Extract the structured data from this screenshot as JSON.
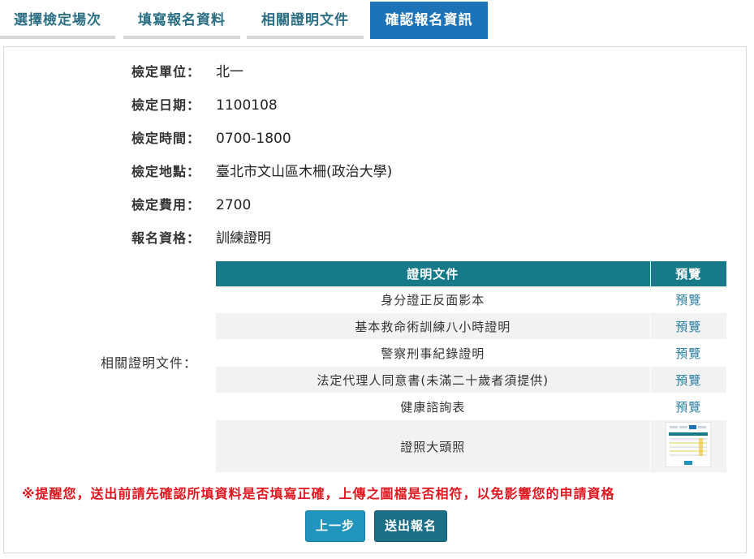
{
  "tabs": [
    {
      "label": "選擇檢定場次",
      "active": false
    },
    {
      "label": "填寫報名資料",
      "active": false
    },
    {
      "label": "相關證明文件",
      "active": false
    },
    {
      "label": "確認報名資訊",
      "active": true
    }
  ],
  "fields": {
    "unit": {
      "label": "檢定單位：",
      "value": "北一"
    },
    "date": {
      "label": "檢定日期：",
      "value": "1100108"
    },
    "time": {
      "label": "檢定時間：",
      "value": "0700-1800"
    },
    "location": {
      "label": "檢定地點：",
      "value": "臺北市文山區木柵(政治大學)"
    },
    "fee": {
      "label": "檢定費用：",
      "value": "2700"
    },
    "qualification": {
      "label": "報名資格：",
      "value": "訓練證明"
    }
  },
  "documents": {
    "section_label": "相關證明文件：",
    "headers": {
      "doc": "證明文件",
      "preview": "預覽"
    },
    "rows": [
      {
        "name": "身分證正反面影本",
        "preview": "預覽"
      },
      {
        "name": "基本救命術訓練八小時證明",
        "preview": "預覽"
      },
      {
        "name": "警察刑事紀錄證明",
        "preview": "預覽"
      },
      {
        "name": "法定代理人同意書(未滿二十歲者須提供)",
        "preview": "預覽"
      },
      {
        "name": "健康諮詢表",
        "preview": "預覽"
      }
    ],
    "photo_row": {
      "name": "證照大頭照",
      "thumbnail": "uploaded-photo-thumbnail"
    }
  },
  "warning": "※提醒您，送出前請先確認所填資料是否填寫正確，上傳之圖檔是否相符，以免影響您的申請資格",
  "buttons": {
    "prev": "上一步",
    "submit": "送出報名"
  },
  "colors": {
    "tab_active_bg": "#1d73b7",
    "tab_text": "#2b6f84",
    "table_header_bg": "#177a89",
    "link": "#2a7d9f",
    "warning_text": "#e0171e",
    "btn_prev_bg": "#2194bd",
    "btn_submit_bg": "#1b6f86"
  }
}
